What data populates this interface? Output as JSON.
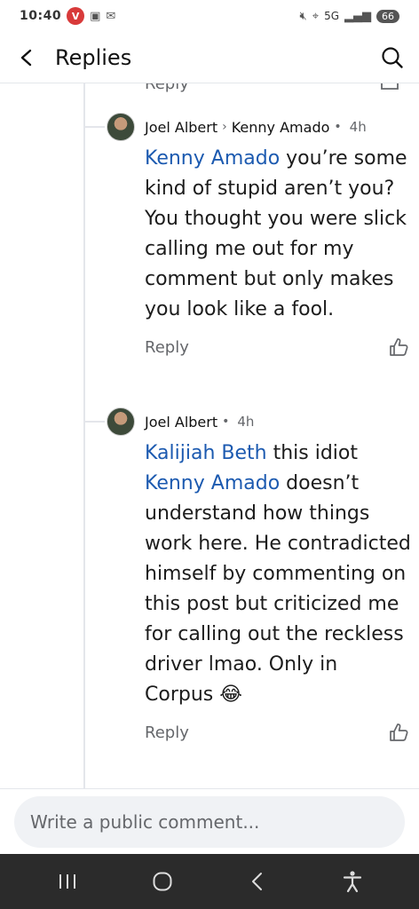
{
  "status_bar": {
    "time": "10:40",
    "network": "5G",
    "battery": "66"
  },
  "header": {
    "title": "Replies"
  },
  "thread": {
    "partial_reply_label": "Reply",
    "comments": [
      {
        "author": "Joel Albert",
        "reply_to": "Kenny Amado",
        "time": "4h",
        "mention": "Kenny Amado",
        "text": " you’re some kind of stupid aren’t you? You thought you were slick calling me out for my comment but only makes you look like a fool.",
        "reply_label": "Reply"
      },
      {
        "author": "Joel Albert",
        "time": "4h",
        "mention_1": "Kalijiah Beth",
        "text_1": " this idiot ",
        "mention_2": "Kenny Amado",
        "text_2": " doesn’t understand how things work here. He contradicted himself by commenting on this post but criticized me for calling out the reckless driver lmao. Only in Corpus ",
        "emoji": "😂",
        "reply_label": "Reply"
      }
    ]
  },
  "composer": {
    "placeholder": "Write a public comment..."
  },
  "colors": {
    "mention": "#1c5ab0",
    "secondary_text": "#65676b",
    "nav_bar": "#2b2b2b"
  },
  "icons": {
    "back": "chevron-left-icon",
    "search": "search-icon",
    "like": "thumbs-up-icon"
  }
}
